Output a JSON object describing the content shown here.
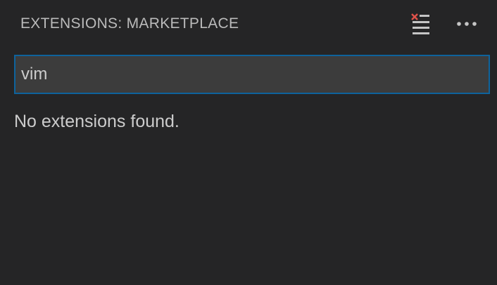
{
  "header": {
    "title": "EXTENSIONS: MARKETPLACE",
    "actions": [
      {
        "icon": "clear-extensions-icon",
        "label": "Clear Extensions Input"
      },
      {
        "icon": "more-actions-icon",
        "label": "More Actions..."
      }
    ]
  },
  "search": {
    "value": "vim"
  },
  "results": {
    "message": "No extensions found."
  },
  "colors": {
    "background": "#252526",
    "input_background": "#3c3c3c",
    "focus_border": "#0e639c",
    "text": "#cccccc",
    "clear_icon_accent": "#e0524a"
  }
}
